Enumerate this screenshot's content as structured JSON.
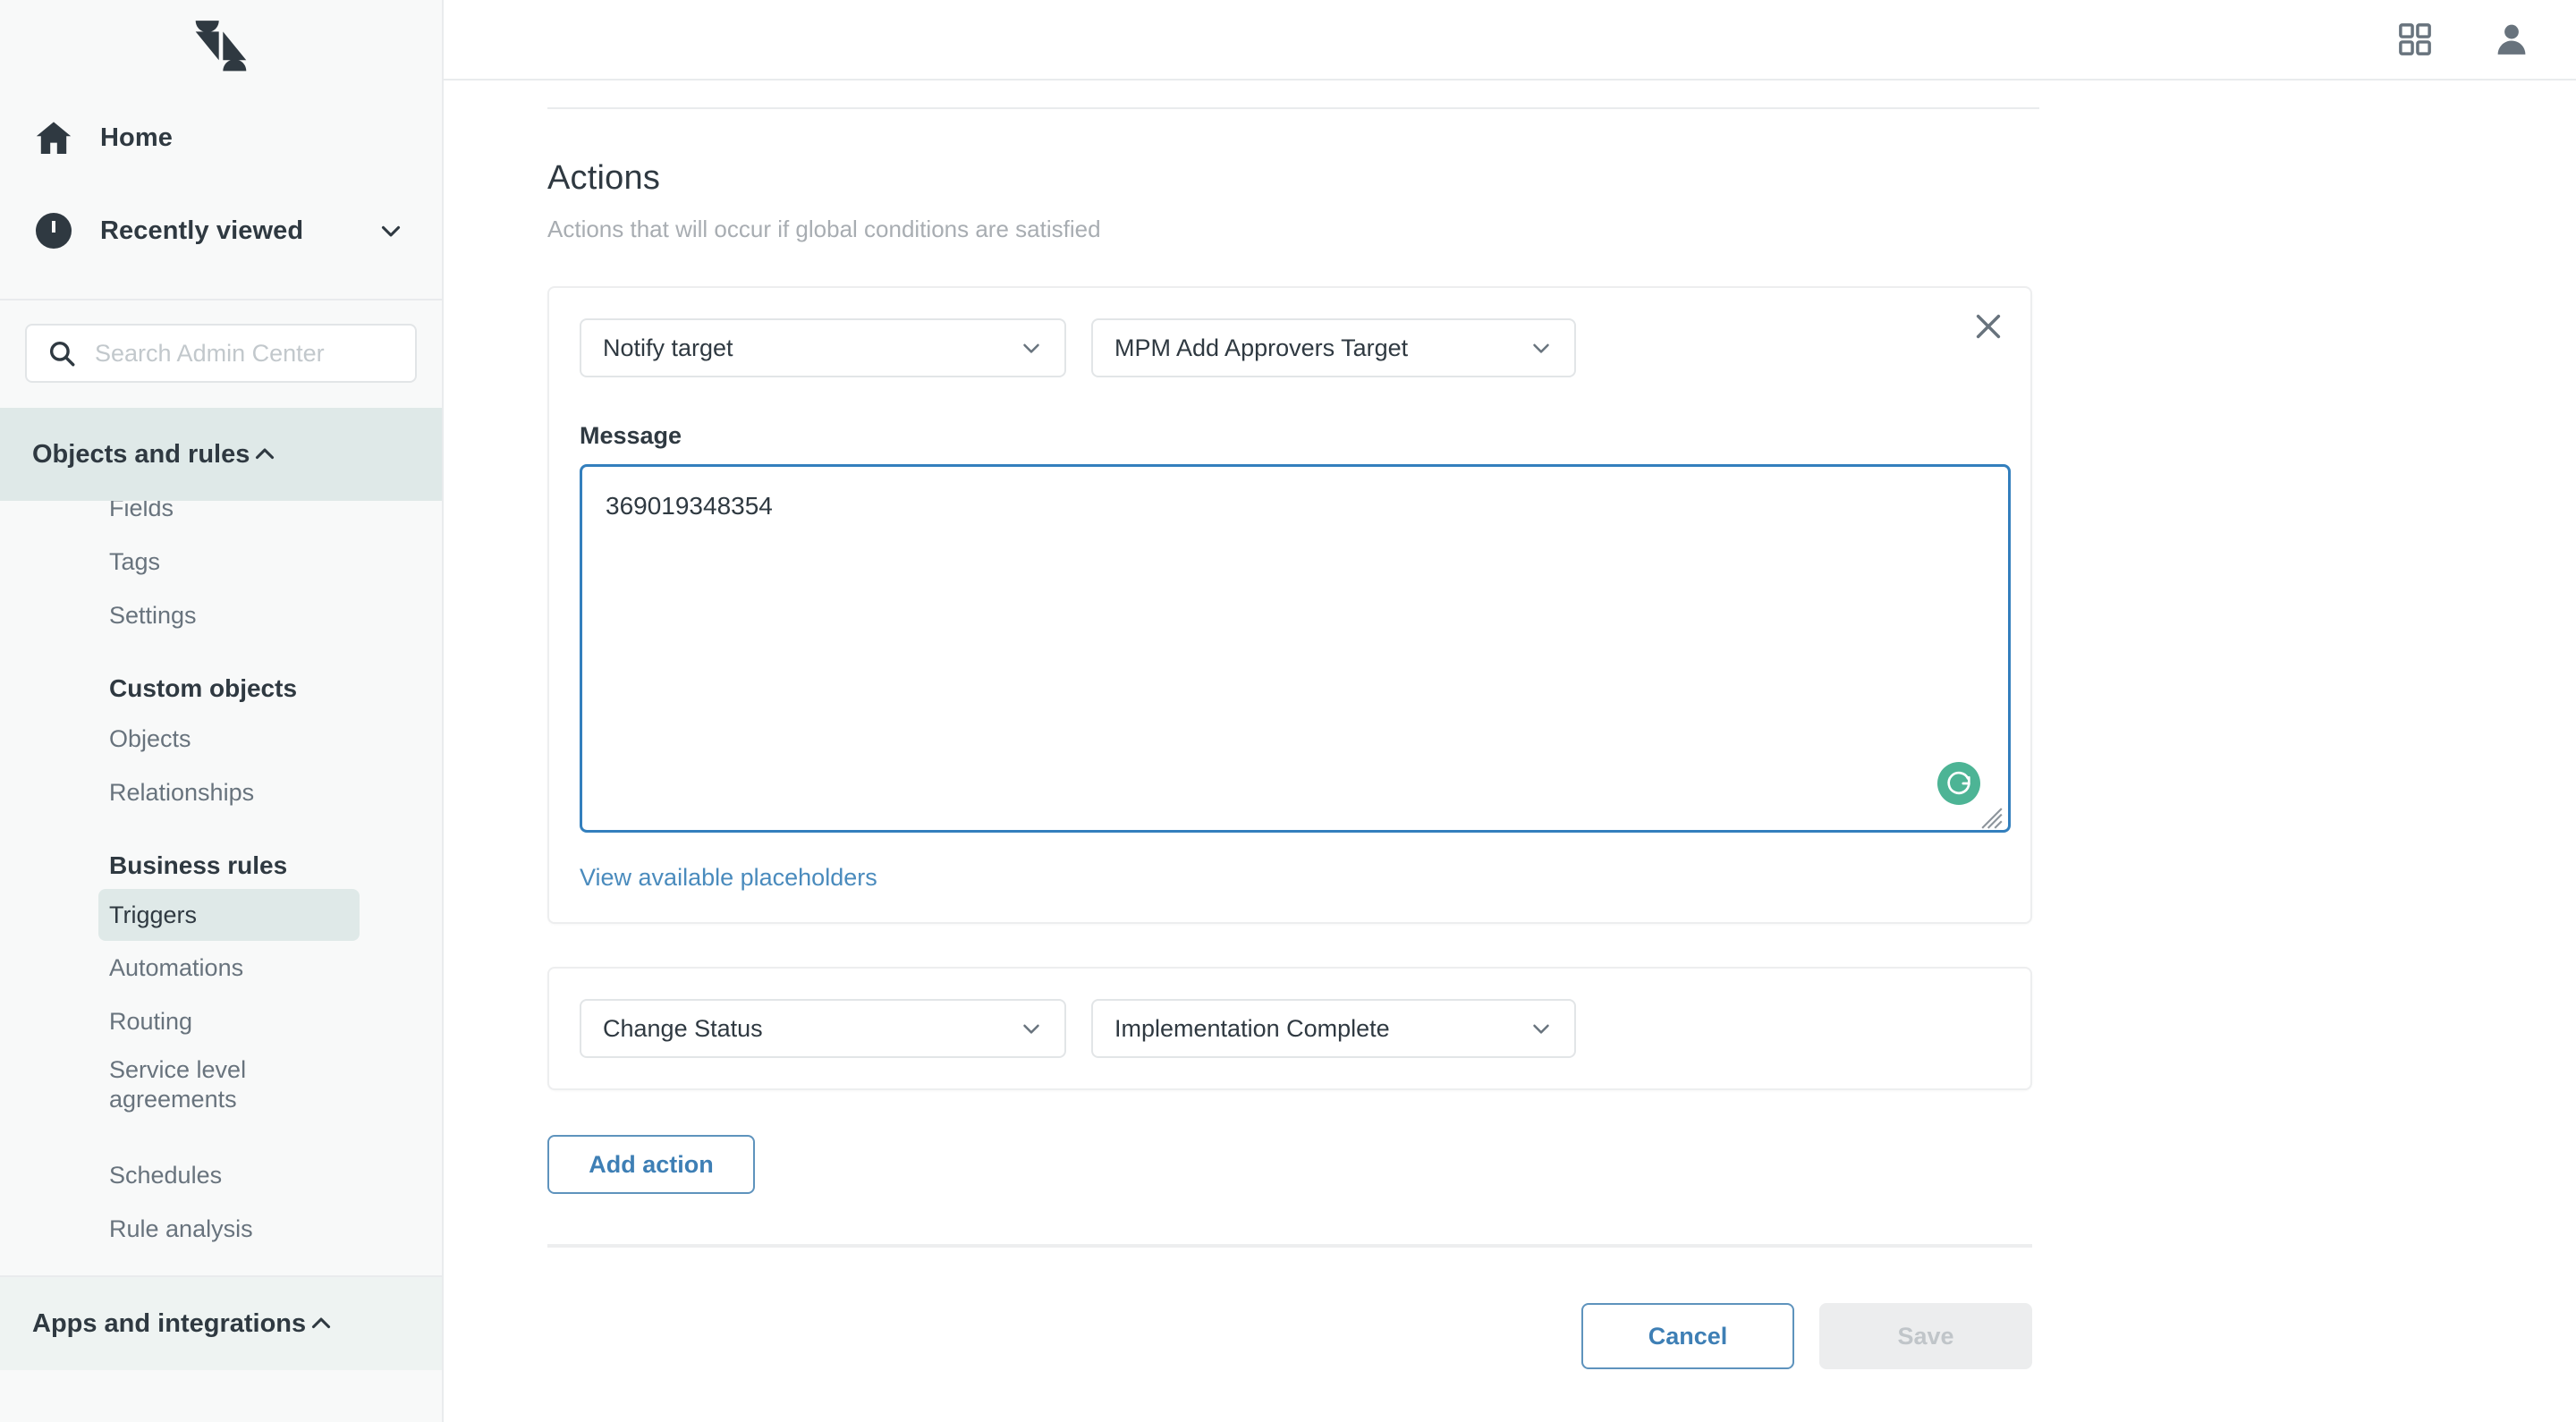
{
  "app": {
    "logo_icon": "zendesk-logo-icon",
    "brand_color": "#2f3941"
  },
  "topbar": {
    "products_icon": "grid-apps-icon",
    "account_icon": "user-avatar-icon"
  },
  "sidebar": {
    "nav": [
      {
        "label": "Home",
        "icon": "home-icon",
        "expandable": false
      },
      {
        "label": "Recently viewed",
        "icon": "clock-icon",
        "expandable": true,
        "chevron": "chevron-down-icon"
      }
    ],
    "search": {
      "placeholder": "Search Admin Center",
      "value": "",
      "icon": "search-icon"
    },
    "section": {
      "label": "Objects and rules",
      "icon": "objects-and-rules-icon",
      "chevron": "chevron-up-icon",
      "expanded": true
    },
    "clipped_item": "Fields",
    "items_top": [
      "Tags",
      "Settings"
    ],
    "groups": [
      {
        "title": "Custom objects",
        "items": [
          {
            "label": "Objects",
            "active": false
          },
          {
            "label": "Relationships",
            "active": false
          }
        ]
      },
      {
        "title": "Business rules",
        "items": [
          {
            "label": "Triggers",
            "active": true
          },
          {
            "label": "Automations",
            "active": false
          },
          {
            "label": "Routing",
            "active": false
          },
          {
            "label": "Service level agreements",
            "active": false,
            "two_line": true
          },
          {
            "label": "Schedules",
            "active": false
          },
          {
            "label": "Rule analysis",
            "active": false
          }
        ]
      }
    ],
    "apps_section": {
      "label": "Apps and integrations",
      "icon": "apps-grid-plus-icon",
      "chevron": "chevron-up-icon"
    }
  },
  "main": {
    "section_title": "Actions",
    "section_subtitle": "Actions that will occur if global conditions are satisfied",
    "actions": [
      {
        "type": "notify-target",
        "field_select": {
          "value": "Notify target",
          "chevron": "chevron-down-icon"
        },
        "target_select": {
          "value": "MPM Add Approvers Target",
          "chevron": "chevron-down-icon"
        },
        "message_label": "Message",
        "message_value": "369019348354",
        "message_placeholder": "",
        "grammarly_badge": "grammarly-icon",
        "resize_handle": "resize-grip-icon",
        "placeholders_link": "View available placeholders",
        "close_icon": "close-icon"
      },
      {
        "type": "change-status",
        "field_select": {
          "value": "Change Status",
          "chevron": "chevron-down-icon"
        },
        "target_select": {
          "value": "Implementation Complete",
          "chevron": "chevron-down-icon"
        }
      }
    ],
    "add_action_label": "Add action",
    "footer": {
      "cancel_label": "Cancel",
      "save_label": "Save",
      "save_disabled": true
    }
  },
  "colors": {
    "accent_link": "#4a8bbd",
    "accent_button": "#3e7fb5",
    "focus_border": "#337fbd",
    "sidebar_bg": "#f8f9f9",
    "active_nav_bg": "#dfe9e8",
    "grammarly_green": "#4db495",
    "text_primary": "#2f3941",
    "text_muted": "#68737d"
  }
}
